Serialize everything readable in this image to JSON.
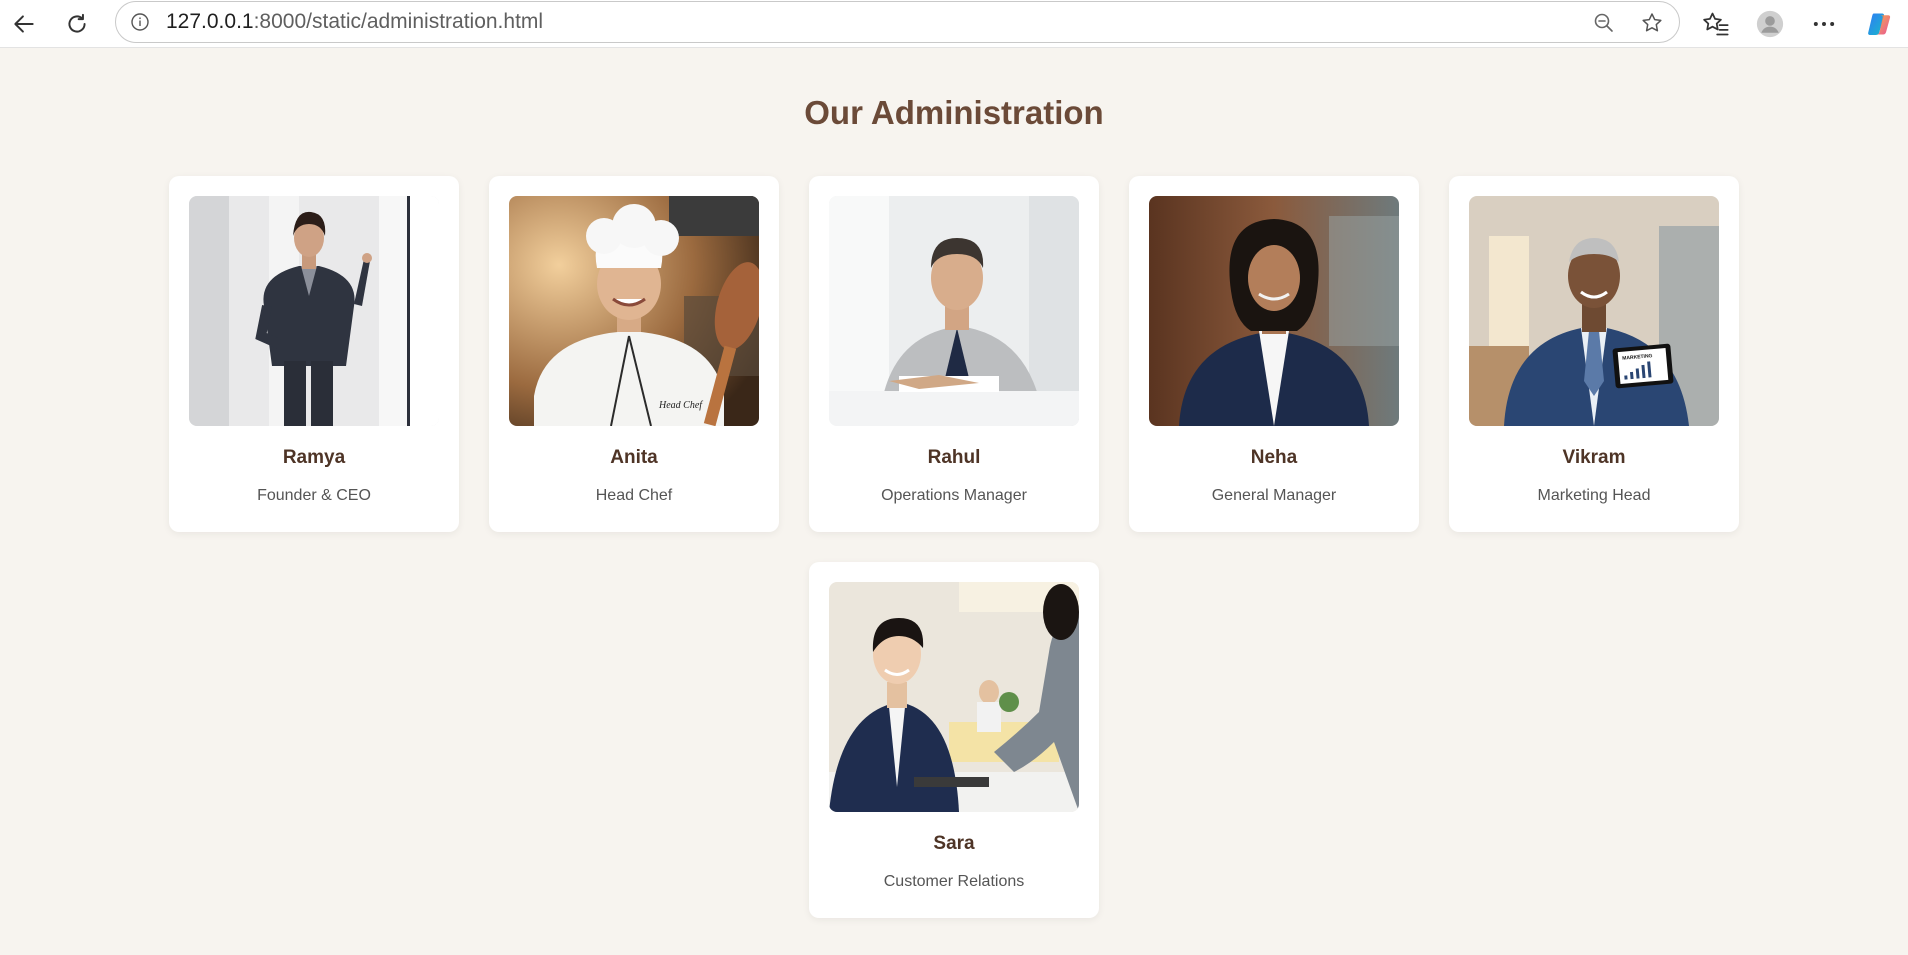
{
  "browser": {
    "url_host": "127.0.0.1",
    "url_path": ":8000/static/administration.html",
    "icons": [
      "back-arrow-icon",
      "refresh-icon",
      "info-icon",
      "zoom-out-icon",
      "star-icon",
      "favorites-icon",
      "profile-icon",
      "more-icon",
      "copilot-icon"
    ]
  },
  "page": {
    "title": "Our Administration"
  },
  "team": [
    {
      "name": "Ramya",
      "role": "Founder & CEO",
      "photo": "woman in dark business suit"
    },
    {
      "name": "Anita",
      "role": "Head Chef",
      "photo": "smiling chef in white hat"
    },
    {
      "name": "Rahul",
      "role": "Operations Manager",
      "photo": "man in grey suit at desk"
    },
    {
      "name": "Neha",
      "role": "General Manager",
      "photo": "woman in navy suit"
    },
    {
      "name": "Vikram",
      "role": "Marketing Head",
      "photo": "man holding marketing tablet"
    },
    {
      "name": "Sara",
      "role": "Customer Relations",
      "photo": "receptionist greeting guest"
    }
  ],
  "photo_text": {
    "chef_coat": "Head Chef",
    "tablet": "MARKETING"
  },
  "colors": {
    "background": "#f7f4ef",
    "title": "#6b4a38",
    "name": "#4e3426",
    "card": "#ffffff"
  }
}
